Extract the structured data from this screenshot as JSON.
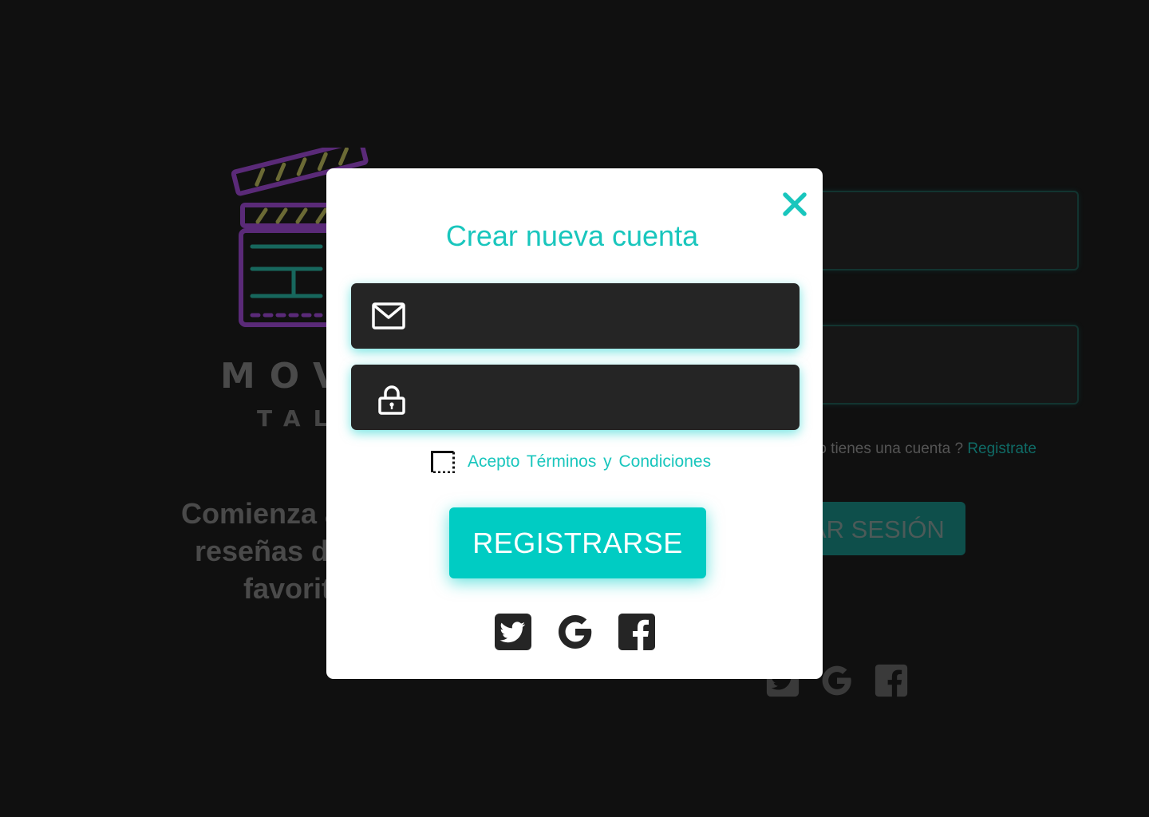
{
  "background": {
    "logo": {
      "word": "MOV",
      "sub": "TAL"
    },
    "tagline": [
      "Comienza a cor",
      "reseñas de tu",
      "favorit"
    ],
    "account_prompt": "¿No tienes una cuenta ?",
    "register_link": "Registrate",
    "login_button": "AR SESIÓN",
    "social_icons": [
      "twitter-icon",
      "google-icon",
      "facebook-icon"
    ]
  },
  "modal": {
    "title": "Crear nueva cuenta",
    "close_icon": "close-icon",
    "email": {
      "icon": "envelope-icon",
      "value": "",
      "placeholder": ""
    },
    "password": {
      "icon": "lock-icon",
      "value": "",
      "placeholder": ""
    },
    "terms": {
      "checked": false,
      "label": "Acepto Términos  y  Condiciones"
    },
    "register_button": "REGISTRARSE",
    "social_icons": [
      "twitter-icon",
      "google-icon",
      "facebook-icon"
    ]
  },
  "colors": {
    "accent": "#00ccc3",
    "accent_text": "#19c6bd",
    "field_bg": "#252525",
    "page_bg": "#101010",
    "modal_bg": "#ffffff",
    "icon_dark": "#252525",
    "logo_purple": "#7a2bb0",
    "logo_teal": "#1fb9a8"
  }
}
